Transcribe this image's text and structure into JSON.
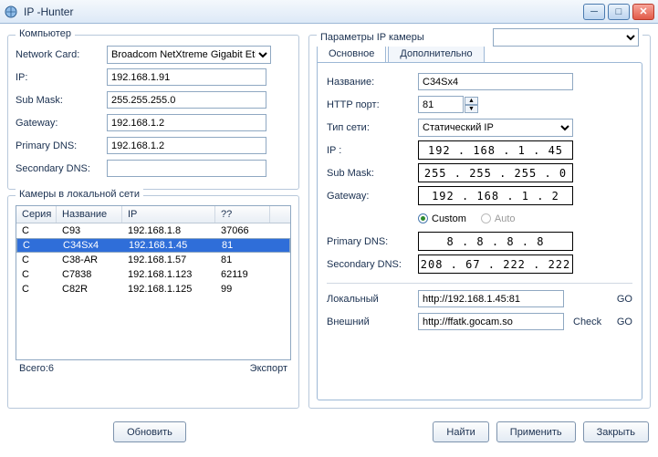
{
  "window": {
    "title": "IP  -Hunter"
  },
  "computer": {
    "legend": "Компьютер",
    "nic_label": "Network Card:",
    "nic_value": "Broadcom NetXtreme Gigabit Ethe",
    "ip_label": "IP:",
    "ip": "192.168.1.91",
    "mask_label": "Sub Mask:",
    "mask": "255.255.255.0",
    "gw_label": "Gateway:",
    "gw": "192.168.1.2",
    "dns1_label": "Primary DNS:",
    "dns1": "192.168.1.2",
    "dns2_label": "Secondary DNS:",
    "dns2": ""
  },
  "lan": {
    "legend": "Камеры в локальной сети",
    "headers": {
      "series": "Серия",
      "name": "Название",
      "ip": "IP",
      "port": "??"
    },
    "rows": [
      {
        "s": "C",
        "n": "C93",
        "ip": "192.168.1.8",
        "p": "37066",
        "sel": false
      },
      {
        "s": "C",
        "n": "C34Sx4",
        "ip": "192.168.1.45",
        "p": "81",
        "sel": true
      },
      {
        "s": "C",
        "n": "C38-AR",
        "ip": "192.168.1.57",
        "p": "81",
        "sel": false
      },
      {
        "s": "C",
        "n": "C7838",
        "ip": "192.168.1.123",
        "p": "62119",
        "sel": false
      },
      {
        "s": "C",
        "n": "C82R",
        "ip": "192.168.1.125",
        "p": "99",
        "sel": false
      }
    ],
    "total_label": "Всего:6",
    "export_label": "Экспорт",
    "refresh_btn": "Обновить"
  },
  "params": {
    "legend": "Параметры IP камеры",
    "tab_main": "Основное",
    "tab_extra": "Дополнительно",
    "name_label": "Название:",
    "name": "C34Sx4",
    "http_label": "HTTP порт:",
    "http": "81",
    "nettype_label": "Тип сети:",
    "nettype": "Статический IP",
    "ip_label": "IP  :",
    "ip": "192 . 168 .  1  .  45",
    "mask_label": "Sub Mask:",
    "mask": "255 . 255 . 255 .  0",
    "gw_label": "Gateway:",
    "gw": "192 . 168 .  1  .  2",
    "custom_label": "Custom",
    "auto_label": "Auto",
    "dns1_label": "Primary DNS:",
    "dns1": "8  .  8  .  8  .  8",
    "dns2_label": "Secondary DNS:",
    "dns2": "208 .  67 . 222 . 222",
    "local_label": "Локальный",
    "local_url": "http://192.168.1.45:81",
    "ext_label": "Внешний",
    "ext_url": "http://ffatk.gocam.so",
    "go": "GO",
    "check": "Check"
  },
  "buttons": {
    "find": "Найти",
    "apply": "Применить",
    "close": "Закрыть"
  }
}
